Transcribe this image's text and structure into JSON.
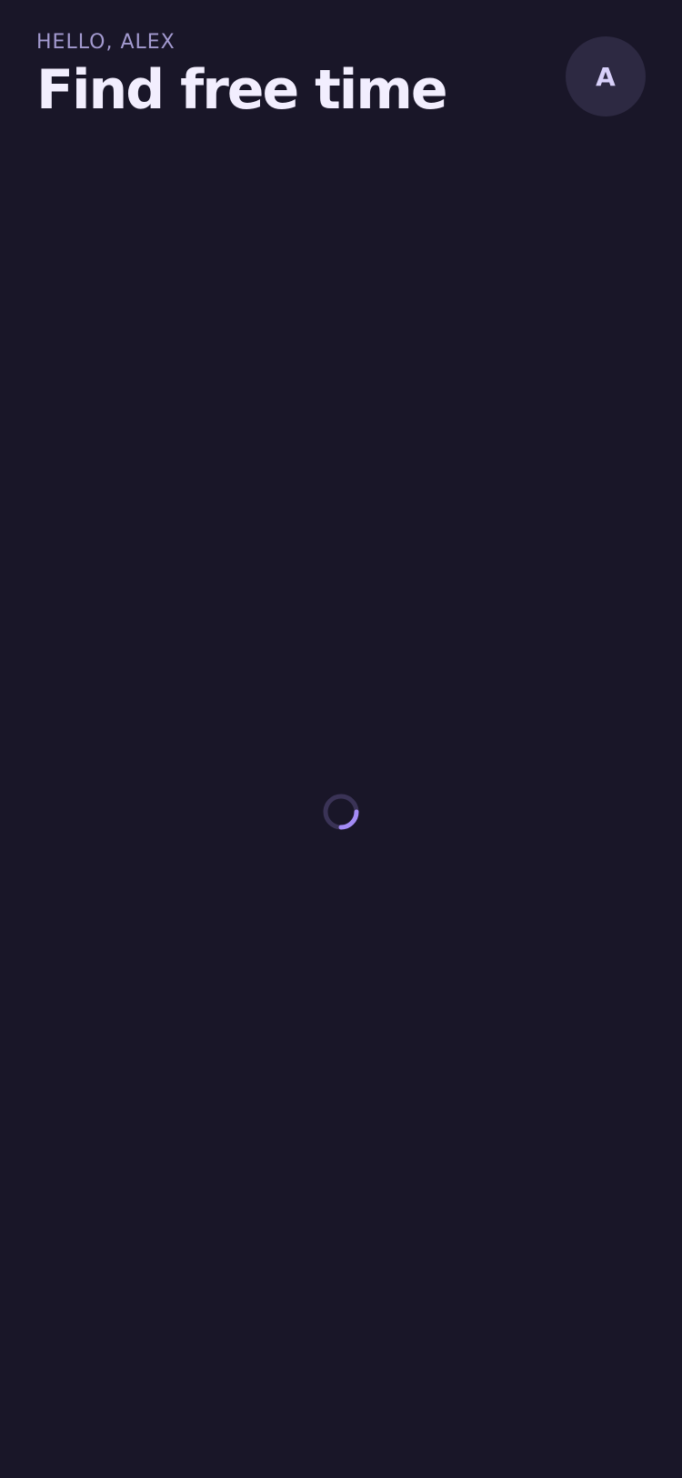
{
  "header": {
    "greeting": "HELLO, ALEX",
    "title": "Find free time"
  },
  "avatar": {
    "initial": "A"
  },
  "loading": {
    "progress": 0.25
  },
  "colors": {
    "background": "#191628",
    "accent": "#a38bf5",
    "muted": "#a39ad0",
    "avatar_bg": "#2d2942",
    "spinner_track": "#3a3356"
  }
}
